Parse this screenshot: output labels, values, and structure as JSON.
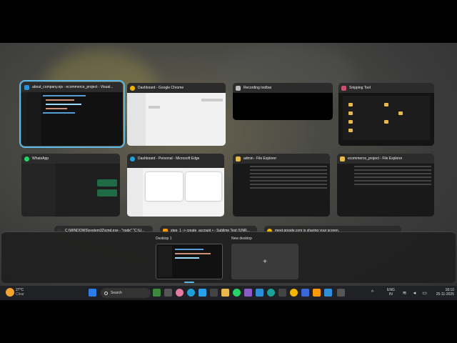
{
  "windows": [
    {
      "title": "about_company.ejs - ecommerce_project - Visual...",
      "icon_color": "#2f8fd8",
      "icon": "vscode-icon"
    },
    {
      "title": "Dashboard - Google Chrome",
      "icon_color": "#f4b400",
      "icon": "chrome-icon"
    },
    {
      "title": "Recording toolbar",
      "icon_color": "#bbbbbb",
      "icon": "recording-icon"
    },
    {
      "title": "Snipping Tool",
      "icon_color": "#c84f6e",
      "icon": "snipping-icon"
    },
    {
      "title": "WhatsApp",
      "icon_color": "#25d366",
      "icon": "whatsapp-icon"
    },
    {
      "title": "Dashboard - Personal - Microsoft Edge",
      "icon_color": "#1fa0d8",
      "icon": "edge-icon"
    },
    {
      "title": "admin - File Explorer",
      "icon_color": "#e9b84a",
      "icon": "folder-icon"
    },
    {
      "title": "ecommerce_project - File Explorer",
      "icon_color": "#e9b84a",
      "icon": "folder-icon"
    }
  ],
  "partial_windows": [
    "C:\\WINDOWS\\system32\\cmd.exe - \"node\"  \"C:\\U...",
    "step_1 -> create_account • - Sublime Text (UNR...",
    "meet.google.com is sharing your screen."
  ],
  "desktops": {
    "desktop1_label": "Desktop 1",
    "new_desktop_label": "New desktop",
    "plus": "+"
  },
  "taskbar": {
    "weather_temp": "27°C",
    "weather_desc": "Clear",
    "search_placeholder": "Search",
    "lang_top": "ENG",
    "lang_bottom": "IN",
    "time": "18:10",
    "date": "25-11-2025"
  },
  "colors": {
    "selection": "#5cb8e6",
    "taskbar_bg": "#1f2124"
  }
}
